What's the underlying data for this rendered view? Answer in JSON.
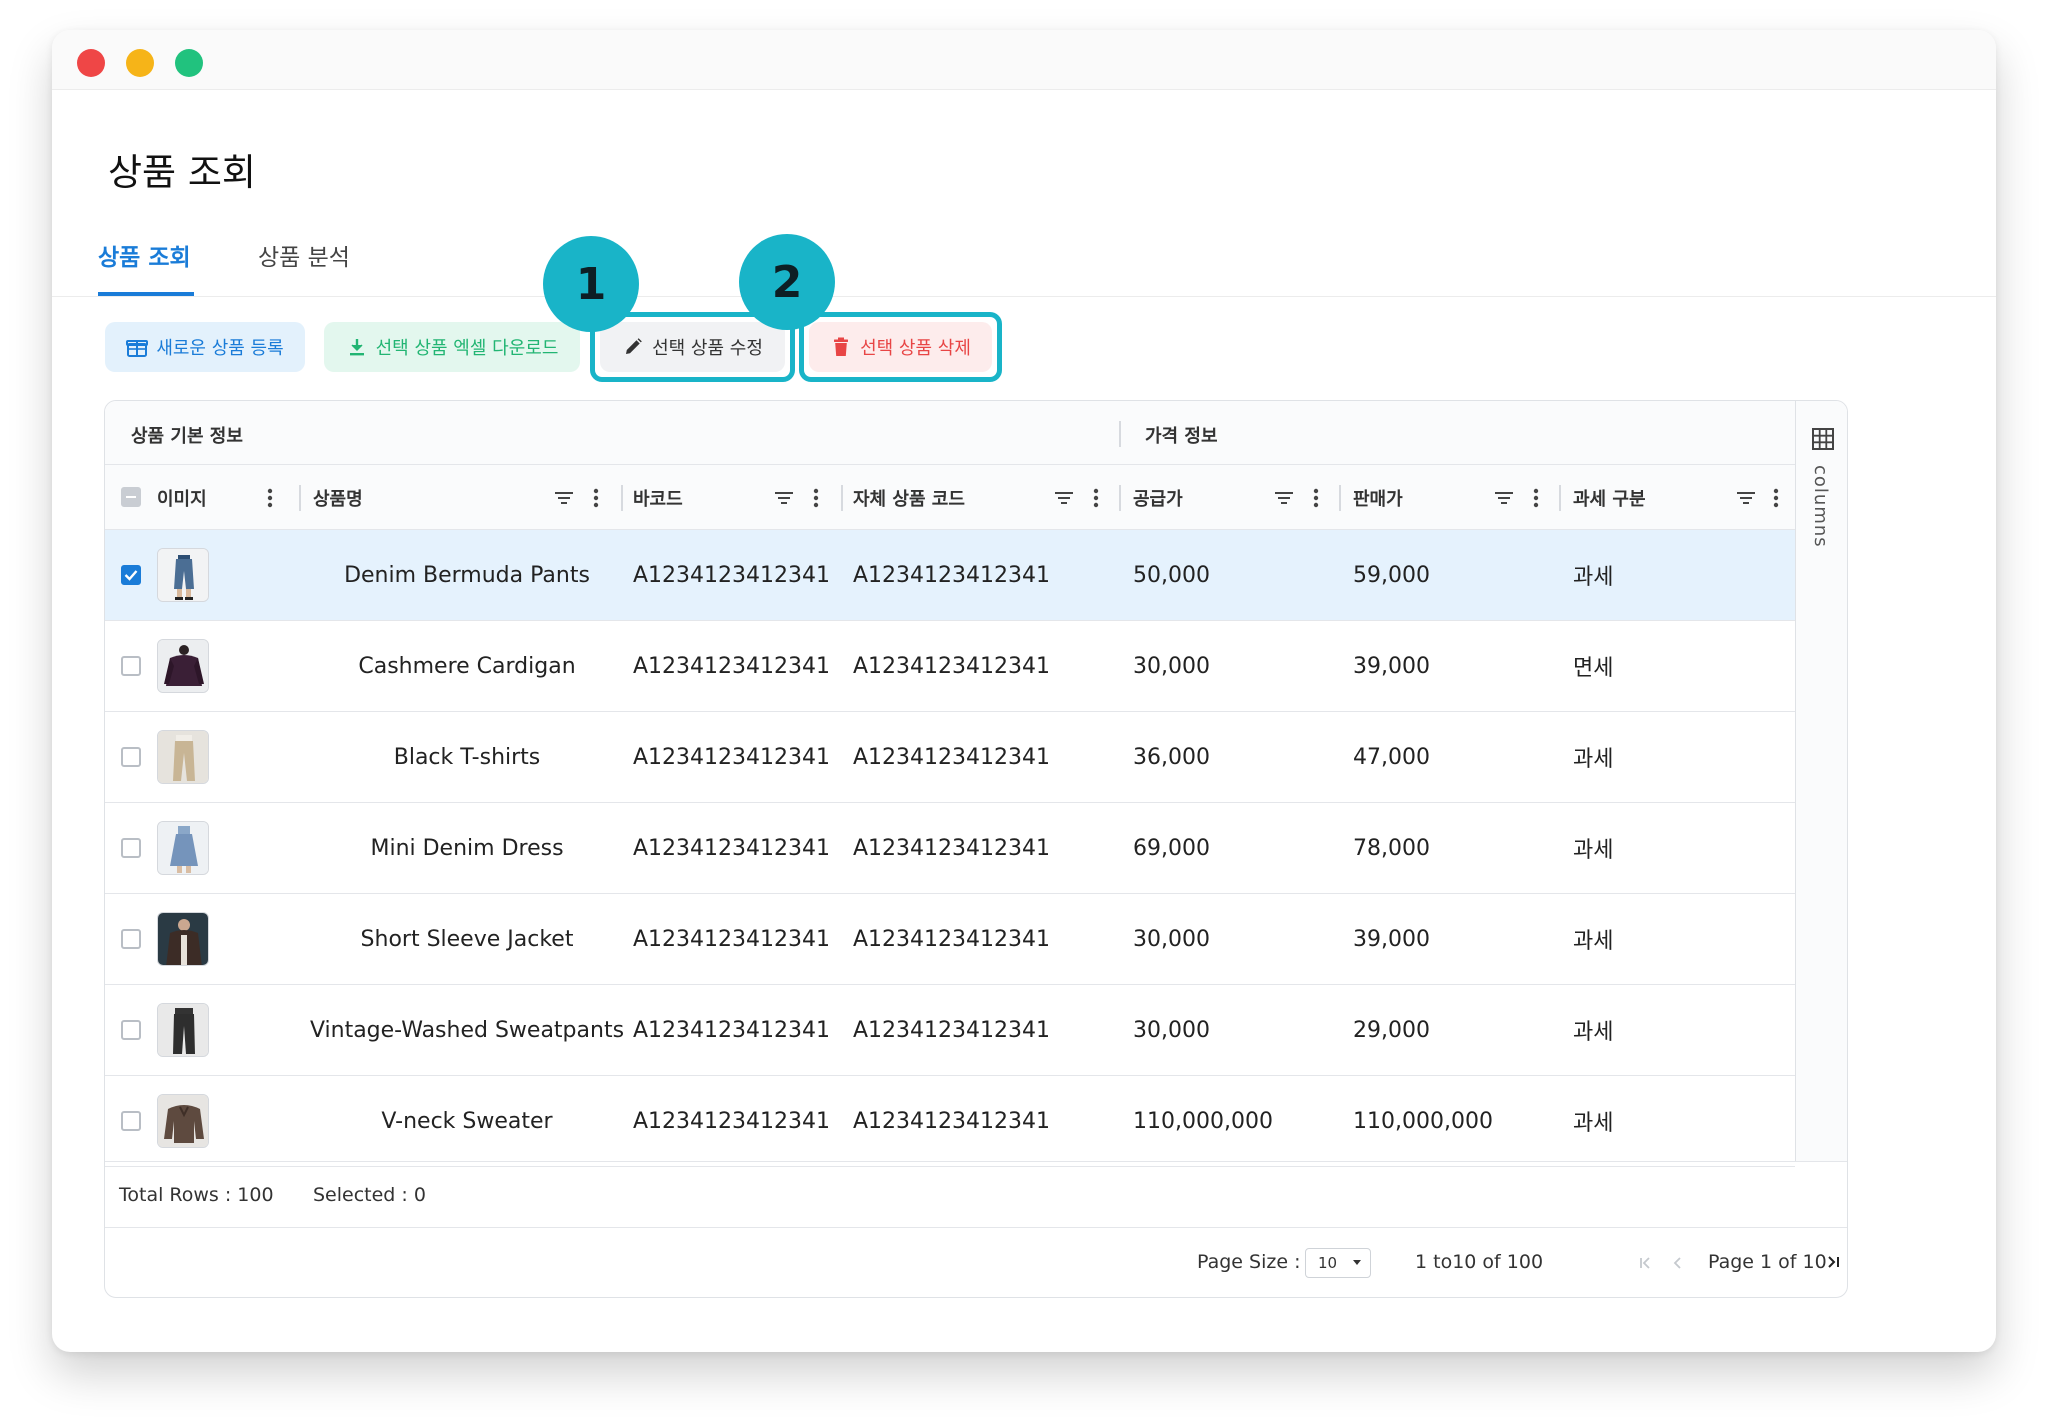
{
  "page": {
    "title": "상품 조회"
  },
  "tabs": [
    {
      "label": "상품 조회",
      "active": true
    },
    {
      "label": "상품 분석",
      "active": false
    }
  ],
  "toolbar": {
    "new_label": "새로운 상품 등록",
    "excel_label": "선택 상품 엑셀 다운로드",
    "edit_label": "선택 상품 수정",
    "delete_label": "선택 상품 삭제",
    "badge_1": "1",
    "badge_2": "2"
  },
  "colors": {
    "accent": "#1a7cd8",
    "highlight": "#19b4c8",
    "excel_green": "#22b573",
    "delete_red": "#e84545",
    "selected_row": "#e5f2fd"
  },
  "grid": {
    "groups": [
      "상품 기본 정보",
      "가격 정보"
    ],
    "columns": [
      "이미지",
      "상품명",
      "바코드",
      "자체 상품 코드",
      "공급가",
      "판매가",
      "과세 구분"
    ],
    "side_panel_label": "columns",
    "rows": [
      {
        "selected": true,
        "image": "denim-shorts-icon",
        "name": "Denim Bermuda Pants",
        "barcode": "A1234123412341",
        "own_code": "A1234123412341",
        "supply_price": "50,000",
        "sale_price": "59,000",
        "tax": "과세"
      },
      {
        "selected": false,
        "image": "cardigan-icon",
        "name": "Cashmere Cardigan",
        "barcode": "A1234123412341",
        "own_code": "A1234123412341",
        "supply_price": "30,000",
        "sale_price": "39,000",
        "tax": "면세"
      },
      {
        "selected": false,
        "image": "beige-pants-icon",
        "name": "Black T-shirts",
        "barcode": "A1234123412341",
        "own_code": "A1234123412341",
        "supply_price": "36,000",
        "sale_price": "47,000",
        "tax": "과세"
      },
      {
        "selected": false,
        "image": "denim-dress-icon",
        "name": "Mini Denim Dress",
        "barcode": "A1234123412341",
        "own_code": "A1234123412341",
        "supply_price": "69,000",
        "sale_price": "78,000",
        "tax": "과세"
      },
      {
        "selected": false,
        "image": "jacket-icon",
        "name": "Short Sleeve Jacket",
        "barcode": "A1234123412341",
        "own_code": "A1234123412341",
        "supply_price": "30,000",
        "sale_price": "39,000",
        "tax": "과세"
      },
      {
        "selected": false,
        "image": "sweatpants-icon",
        "name": "Vintage-Washed Sweatpants",
        "barcode": "A1234123412341",
        "own_code": "A1234123412341",
        "supply_price": "30,000",
        "sale_price": "29,000",
        "tax": "과세"
      },
      {
        "selected": false,
        "image": "sweater-icon",
        "name": "V-neck Sweater",
        "barcode": "A1234123412341",
        "own_code": "A1234123412341",
        "supply_price": "110,000,000",
        "sale_price": "110,000,000",
        "tax": "과세"
      }
    ]
  },
  "status": {
    "total_rows": "Total Rows : 100",
    "selected": "Selected : 0"
  },
  "pagination": {
    "page_size_label": "Page Size :",
    "page_size_value": "10",
    "range": "1 to10 of 100",
    "page_label": "Page 1 of 10"
  }
}
